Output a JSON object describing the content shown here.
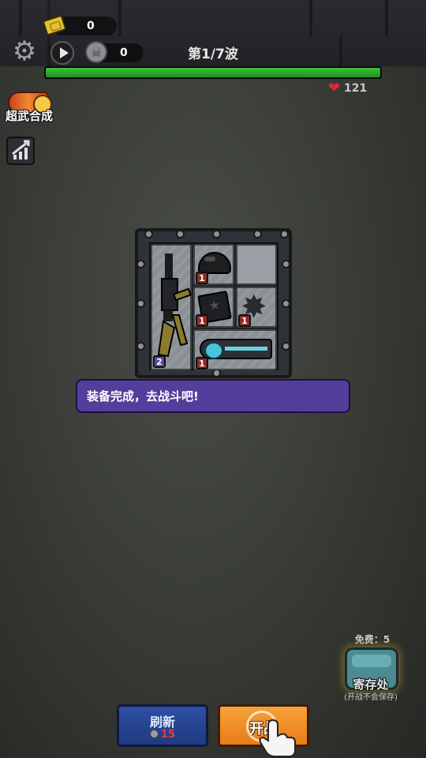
{
  "hud": {
    "ticket_count": "0",
    "kill_count": "0",
    "wave_label": "第1/7波",
    "wave_progress": 1.0,
    "hp": "121"
  },
  "side": {
    "superweapon_label": "超武合成"
  },
  "backpack": {
    "items": [
      {
        "name": "assault-rifle",
        "badge": "2"
      },
      {
        "name": "helmet",
        "badge": "1"
      },
      {
        "name": "armor-book",
        "badge": "1"
      },
      {
        "name": "shuriken",
        "badge": "1"
      },
      {
        "name": "blaster",
        "badge": "1"
      }
    ]
  },
  "dialog": {
    "text": "装备完成，去战斗吧!"
  },
  "storage": {
    "free_label": "免费：5",
    "label": "寄存处",
    "note": "(开战不会保存)"
  },
  "buttons": {
    "refresh_label": "刷新",
    "refresh_cost": "15",
    "start_label": "开战"
  },
  "colors": {
    "wave_bar": "#2fa82c",
    "dialog_bg": "#533e9b",
    "start_button": "#f0902a",
    "refresh_button": "#2a4796",
    "refresh_cost": "#e33f3f"
  }
}
